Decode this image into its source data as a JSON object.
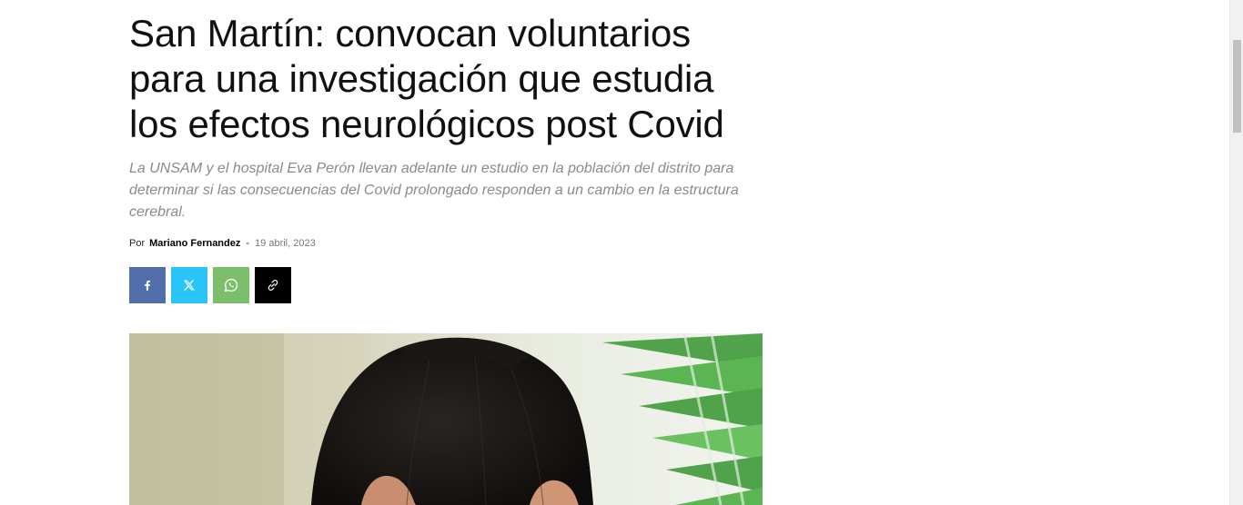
{
  "article": {
    "title": "San Martín: convocan voluntarios para una investigación que estudia los efectos neurológicos post Covid",
    "subtitle": "La UNSAM y el hospital Eva Perón llevan adelante un estudio en la población del distrito para determinar si las consecuencias del Covid prolongado responden a un cambio en la estructura cerebral.",
    "byline": {
      "prefix": "Por",
      "author": "Mariano Fernandez",
      "separator": "-",
      "date": "19 abril, 2023"
    }
  },
  "share": [
    {
      "id": "facebook",
      "icon": "facebook-icon",
      "color": "#516eab"
    },
    {
      "id": "twitter",
      "icon": "x-twitter-icon",
      "color": "#29c5f6"
    },
    {
      "id": "whatsapp",
      "icon": "whatsapp-icon",
      "color": "#7bbf6a"
    },
    {
      "id": "copy-link",
      "icon": "link-icon",
      "color": "#000000"
    }
  ],
  "hero_image": {
    "icon": "woman-holding-head-photo"
  }
}
